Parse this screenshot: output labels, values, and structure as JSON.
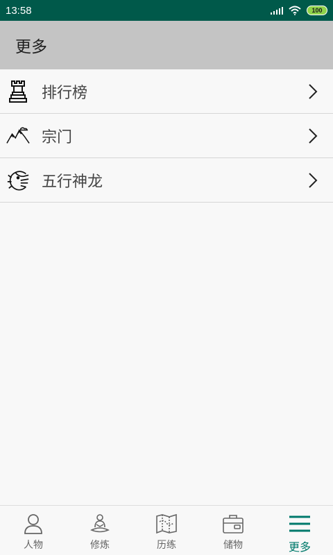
{
  "status_bar": {
    "time": "13:58",
    "battery": "100",
    "background": "#00594a"
  },
  "header": {
    "title": "更多",
    "background": "#c4c4c4"
  },
  "menu": {
    "items": [
      {
        "label": "排行榜",
        "icon": "rook-trophy-icon"
      },
      {
        "label": "宗门",
        "icon": "mountains-icon"
      },
      {
        "label": "五行神龙",
        "icon": "dragon-icon"
      }
    ]
  },
  "bottom_nav": {
    "active_color": "#00796b",
    "items": [
      {
        "label": "人物",
        "icon": "person-icon",
        "active": false
      },
      {
        "label": "修炼",
        "icon": "meditation-icon",
        "active": false
      },
      {
        "label": "历练",
        "icon": "map-icon",
        "active": false
      },
      {
        "label": "储物",
        "icon": "bag-icon",
        "active": false
      },
      {
        "label": "更多",
        "icon": "menu-icon",
        "active": true
      }
    ]
  }
}
